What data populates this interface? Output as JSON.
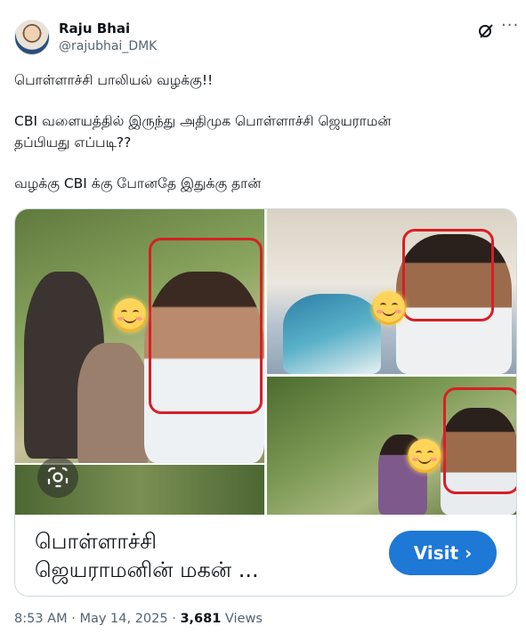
{
  "author": {
    "name": "Raju Bhai",
    "handle": "@rajubhai_DMK"
  },
  "tweet": {
    "lines": [
      "பொள்ளாச்சி பாலியல் வழக்கு!!",
      "CBI வளையத்தில் இருந்து அதிமுக பொள்ளாச்சி ஜெயராமன்",
      "தப்பியது எப்படி??",
      "வழக்கு CBI க்கு போனதே இதுக்கு தான்"
    ]
  },
  "card": {
    "title_line1": "பொள்ளாச்சி",
    "title_line2": "ஜெயராமனின் மகன் ...",
    "visit_label": "Visit",
    "visit_chevron": "›"
  },
  "meta": {
    "time": "8:53 AM",
    "separator": "·",
    "date": "May 14, 2025",
    "views_count": "3,681",
    "views_label": "Views"
  },
  "icons": {
    "grok": "grok-icon",
    "more": "more-icon",
    "lens": "lens-icon"
  },
  "colors": {
    "accent": "#1d78d6",
    "secondary_text": "#536471",
    "highlight_box": "#d71f26"
  }
}
